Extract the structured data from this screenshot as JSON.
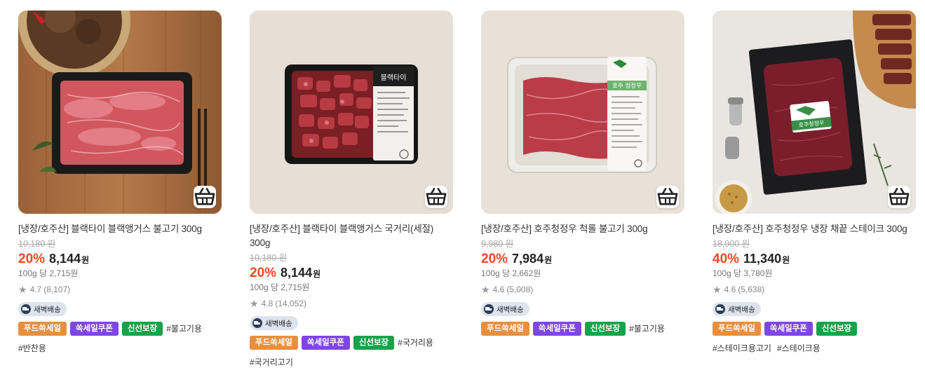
{
  "products": [
    {
      "name": "[냉장/호주산] 블랙타이 블랙앵거스 불고기 300g",
      "original_price": "10,180 원",
      "discount_rate": "20%",
      "price": "8,144",
      "currency": "원",
      "unit_price": "100g 당 2,715원",
      "rating": "4.7",
      "review_count": "(8,107)",
      "delivery": "새벽배송",
      "badges": [
        "푸드쏙세일",
        "쏙세일쿠폰",
        "신선보장"
      ],
      "hashtags": [
        "#불고기용",
        "#반찬용"
      ]
    },
    {
      "name": "[냉장/호주산] 블랙타이 블랙앵거스 국거리(세절) 300g",
      "original_price": "10,180 원",
      "discount_rate": "20%",
      "price": "8,144",
      "currency": "원",
      "unit_price": "100g 당 2,715원",
      "rating": "4.8",
      "review_count": "(14,052)",
      "delivery": "새벽배송",
      "badges": [
        "푸드쏙세일",
        "쏙세일쿠폰",
        "신선보장"
      ],
      "hashtags": [
        "#국거리용",
        "#국거리고기"
      ]
    },
    {
      "name": "[냉장/호주산] 호주청정우 척롤 불고기 300g",
      "original_price": "9,980 원",
      "discount_rate": "20%",
      "price": "7,984",
      "currency": "원",
      "unit_price": "100g 당 2,662원",
      "rating": "4.6",
      "review_count": "(5,008)",
      "delivery": "새벽배송",
      "badges": [
        "푸드쏙세일",
        "쏙세일쿠폰",
        "신선보장"
      ],
      "hashtags": [
        "#불고기용"
      ]
    },
    {
      "name": "[냉장/호주산] 호주청정우 냉장 채끝 스테이크 300g",
      "original_price": "18,900 원",
      "discount_rate": "40%",
      "price": "11,340",
      "currency": "원",
      "unit_price": "100g 당 3,780원",
      "rating": "4.6",
      "review_count": "(5,638)",
      "delivery": "새벽배송",
      "badges": [
        "푸드쏙세일",
        "쏙세일쿠폰",
        "신선보장"
      ],
      "hashtags": [
        "#스테이크용고기",
        "#스테이크용"
      ]
    }
  ],
  "package_labels": {
    "p2": "블랙타이",
    "p3": "호주 청정우",
    "p4": "호주청정우"
  },
  "colors": {
    "discount": "#f04a25",
    "badge_food": "#e88f3f",
    "badge_coupon": "#7e46e3",
    "badge_fresh": "#16a34a",
    "delivery_bg": "#dce4ee"
  },
  "icons": {
    "cart": "cart-icon",
    "star": "star-icon",
    "truck": "truck-icon"
  }
}
